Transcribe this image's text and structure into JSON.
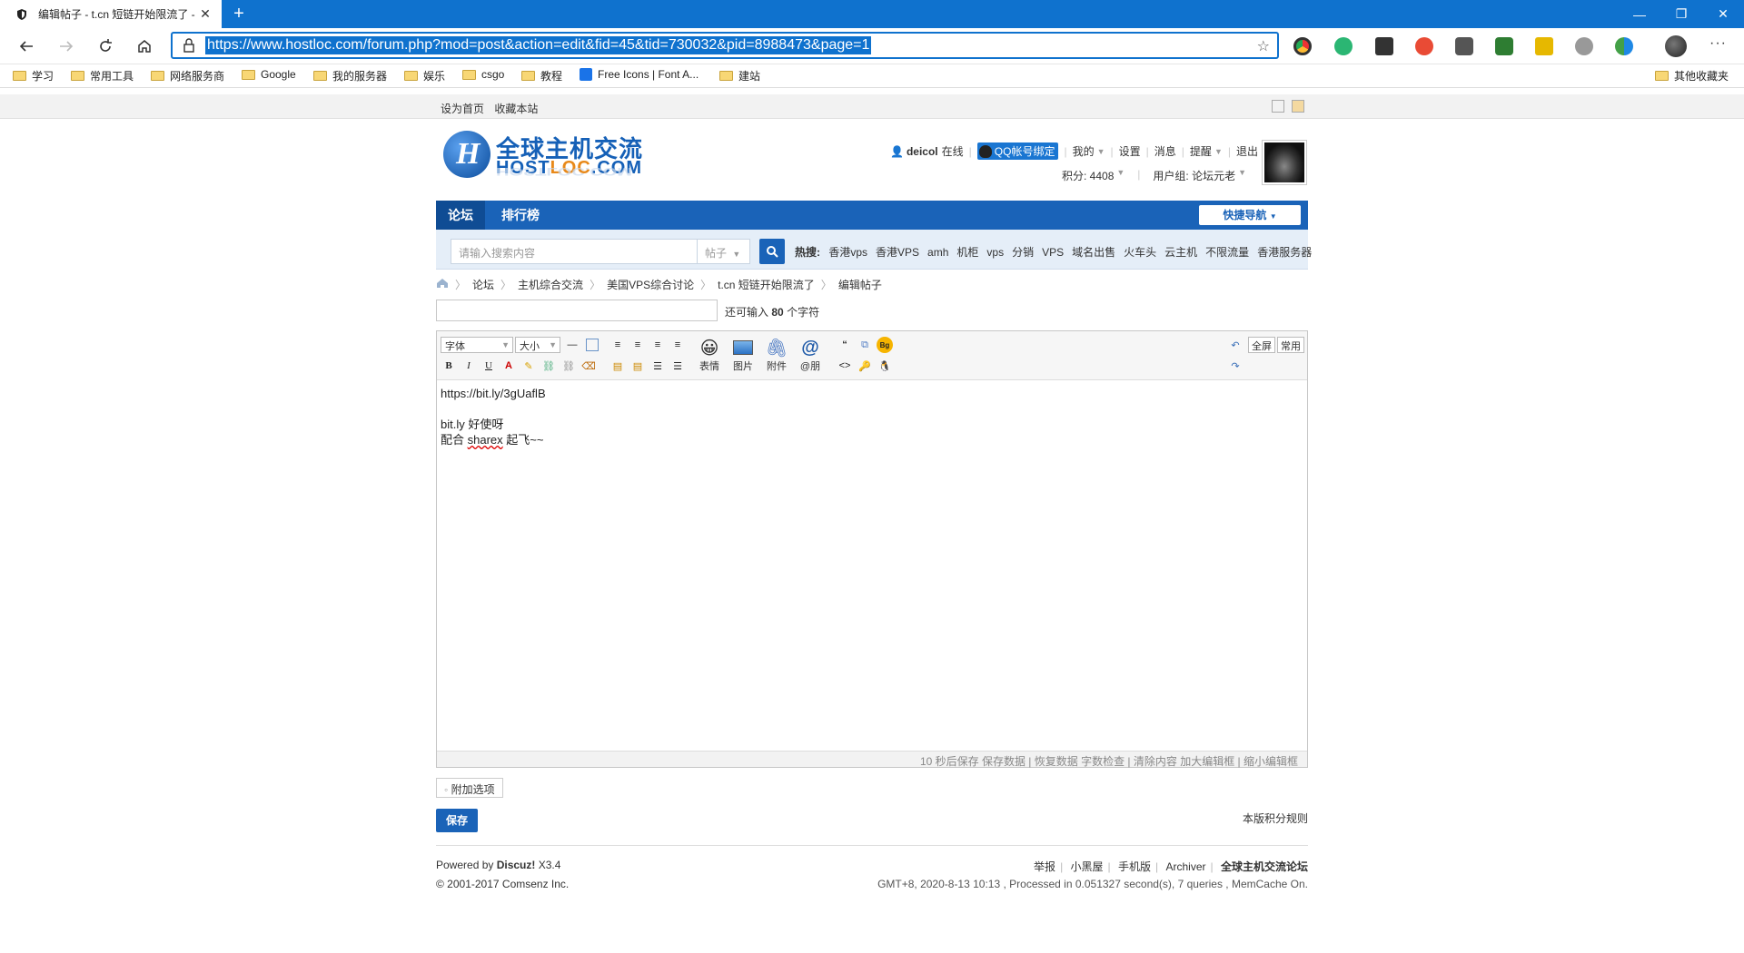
{
  "browser": {
    "tab_title": "编辑帖子 - t.cn 短链开始限流了 -",
    "url": "https://www.hostloc.com/forum.php?mod=post&action=edit&fid=45&tid=730032&pid=8988473&page=1",
    "new_tab": "+",
    "accent": "#0f72ce"
  },
  "bookmarks": [
    "学习",
    "常用工具",
    "网络服务商",
    "Google",
    "我的服务器",
    "娱乐",
    "csgo",
    "教程",
    "Free Icons | Font A...",
    "建站"
  ],
  "other_bookmarks": "其他收藏夹",
  "site_top": {
    "set_home": "设为首页",
    "bookmark_site": "收藏本站"
  },
  "logo": {
    "cn": "全球主机交流",
    "en_a": "HOST",
    "en_b": "LOC",
    "en_c": ".COM",
    "reflection": "HOSTLOC.COM"
  },
  "user": {
    "name": "deicol",
    "status": "在线",
    "qq_bind": "QQ帐号绑定",
    "mine": "我的",
    "settings": "设置",
    "messages": "消息",
    "remind": "提醒",
    "logout": "退出",
    "points": "积分: 4408",
    "group": "用户组: 论坛元老"
  },
  "nav": {
    "forum": "论坛",
    "ranking": "排行榜",
    "quick_nav": "快捷导航"
  },
  "search": {
    "placeholder": "请输入搜索内容",
    "type": "帖子",
    "hot_label": "热搜:",
    "hot": [
      "香港vps",
      "香港VPS",
      "amh",
      "机柜",
      "vps",
      "分销",
      "VPS",
      "域名出售",
      "火车头",
      "云主机",
      "不限流量",
      "香港服务器"
    ]
  },
  "breadcrumb": [
    "论坛",
    "主机综合交流",
    "美国VPS综合讨论",
    "t.cn 短链开始限流了",
    "编辑帖子"
  ],
  "subject": {
    "value": "",
    "remain_prefix": "还可输入",
    "remain_count": "80",
    "remain_suffix": "个字符"
  },
  "editor": {
    "font": "字体",
    "size": "大小",
    "emoticon": "表情",
    "image": "图片",
    "attach": "附件",
    "at": "@朋",
    "fullscreen": "全屏",
    "common": "常用",
    "line1": "https://bit.ly/3gUaflB",
    "line2": "bit.ly 好使呀",
    "line3a": "配合 ",
    "line3b": "sharex",
    "line3c": " 起飞~~",
    "footer": "10 秒后保存 保存数据 | 恢复数据    字数检查 | 清除内容    加大编辑框 | 缩小编辑框"
  },
  "actions": {
    "extra_options": "附加选项",
    "save": "保存",
    "credit_rules": "本版积分规则"
  },
  "footer": {
    "powered_prefix": "Powered by ",
    "powered_name": "Discuz!",
    "powered_ver": " X3.4",
    "copyright_prefix": "© 2001-2017 ",
    "copyright_name": "Comsenz Inc.",
    "links": [
      "举报",
      "小黑屋",
      "手机版",
      "Archiver",
      "全球主机交流论坛"
    ],
    "server_info": "GMT+8, 2020-8-13 10:13 , Processed in 0.051327 second(s), 7 queries , MemCache On."
  }
}
